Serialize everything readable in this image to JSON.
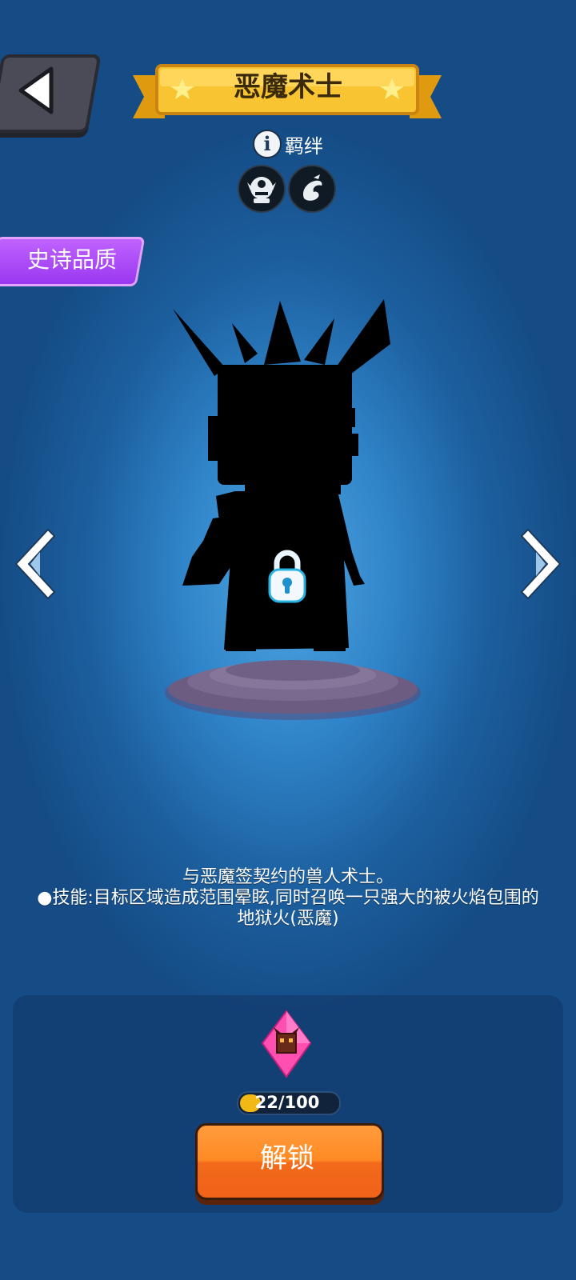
{
  "header": {
    "title": "恶魔术士",
    "back_icon": "back-arrow-icon"
  },
  "bond": {
    "label": "羁绊",
    "info_icon_glyph": "i",
    "factions": [
      "orc-faction-icon",
      "dragon-faction-icon"
    ]
  },
  "quality": {
    "label": "史诗品质",
    "color": "#a648f7"
  },
  "character": {
    "locked": true,
    "lock_icon": "padlock-icon"
  },
  "description": {
    "line1": "与恶魔签契约的兽人术士。",
    "line2": "●技能:目标区域造成范围晕眩,同时召唤一只强大的被火焰包围的地狱火(恶魔)"
  },
  "unlock": {
    "shard_icon": "hero-shard-icon",
    "progress_text": "22/100",
    "progress_fraction": 0.22,
    "button_label": "解锁",
    "button_color": "#ff8a24"
  }
}
